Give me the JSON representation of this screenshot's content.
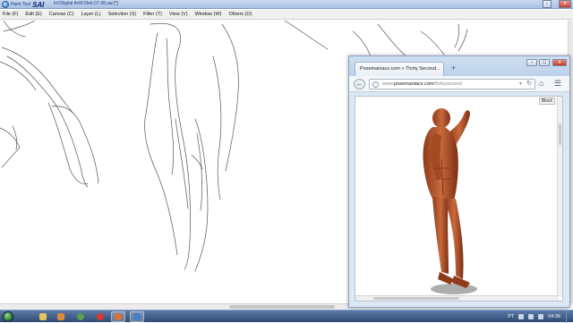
{
  "sai": {
    "app_name": "SAI",
    "app_subtitle": "Paint Tool",
    "document_title": "InVDigital Art\\FXfeb 07-28.sai [*]",
    "window_controls": [
      "-",
      "□",
      "x"
    ],
    "menu": [
      {
        "label": "File (F)"
      },
      {
        "label": "Edit (E)"
      },
      {
        "label": "Canvas (C)"
      },
      {
        "label": "Layer (L)"
      },
      {
        "label": "Selection (S)"
      },
      {
        "label": "Filter (T)"
      },
      {
        "label": "View (V)"
      },
      {
        "label": "Window (W)"
      },
      {
        "label": "Others (O)"
      }
    ]
  },
  "browser": {
    "tab_title": "Posemaniacs.com » Thirty Second...",
    "new_tab": "+",
    "window_controls": [
      "-",
      "□",
      "x"
    ],
    "url_prefix": "www.",
    "url_host": "posemaniacs.com",
    "url_path": "/thirtysecond",
    "badge": "Block",
    "icons": [
      "back-icon",
      "globe-icon",
      "reload-icon",
      "home-icon",
      "menu-icon"
    ]
  },
  "taskbar": {
    "language": "PT",
    "clock": "04:36",
    "apps": [
      "folder",
      "media",
      "chrome",
      "opera",
      "firefox",
      "sai"
    ]
  },
  "colors": {
    "muscle": "#b5582f",
    "muscle_dark": "#7c2f14",
    "taskbar": "#2f4a75"
  }
}
